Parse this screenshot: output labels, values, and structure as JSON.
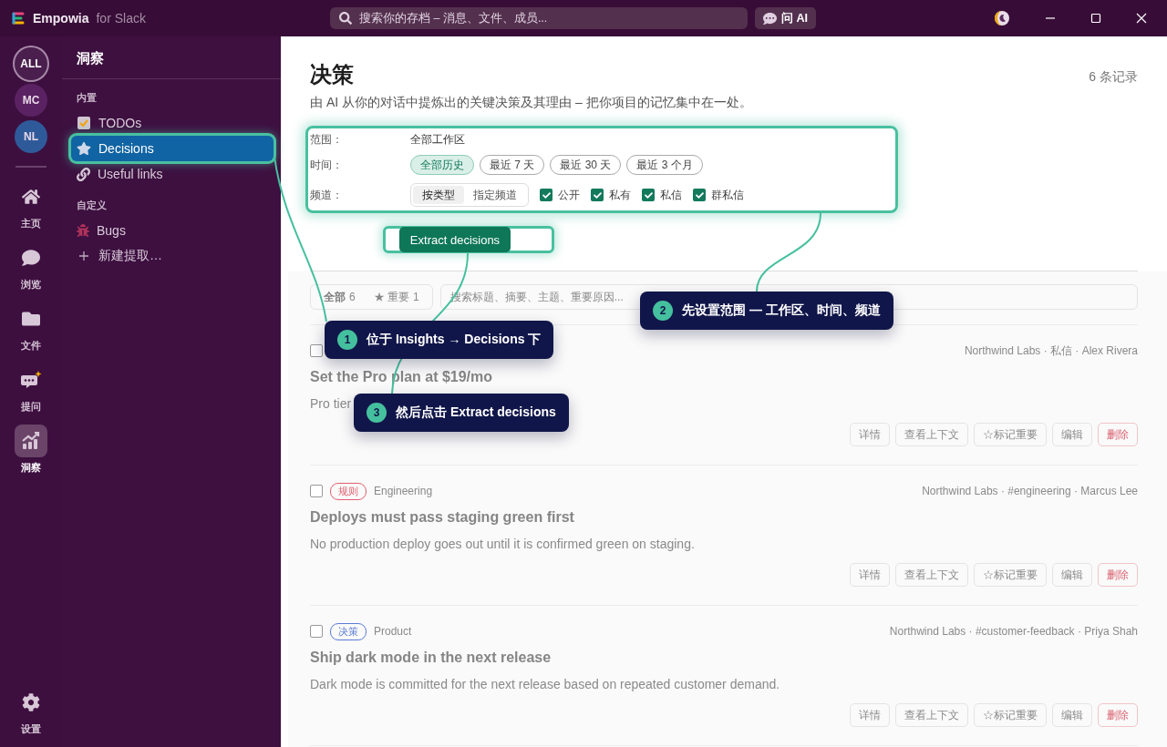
{
  "app": {
    "name": "Empowia",
    "suffix": "for Slack"
  },
  "search": {
    "placeholder": "搜索你的存档 – 消息、文件、成员..."
  },
  "ask_ai": "问 AI",
  "workspaces": [
    {
      "label": "ALL",
      "selected": true,
      "color": "#4a1f4e"
    },
    {
      "label": "MC",
      "selected": false,
      "color": "#5a2262"
    },
    {
      "label": "NL",
      "selected": false,
      "color": "#2f5a9a"
    }
  ],
  "nav": [
    {
      "label": "主页",
      "kind": "home",
      "selected": false
    },
    {
      "label": "浏览",
      "kind": "browse",
      "selected": false
    },
    {
      "label": "文件",
      "kind": "files",
      "selected": false
    },
    {
      "label": "提问",
      "kind": "ask",
      "selected": false
    },
    {
      "label": "洞察",
      "kind": "insights",
      "selected": true
    }
  ],
  "settings": {
    "label": "设置"
  },
  "sidebar": {
    "title": "洞察",
    "sections": [
      {
        "heading": "内置",
        "items": [
          {
            "label": "TODOs",
            "kind": "todo",
            "selected": false,
            "spotlight": false
          },
          {
            "label": "Decisions",
            "kind": "star",
            "selected": true,
            "spotlight": true
          },
          {
            "label": "Useful links",
            "kind": "link",
            "selected": false,
            "spotlight": false
          }
        ]
      },
      {
        "heading": "自定义",
        "items": [
          {
            "label": "Bugs",
            "kind": "bug",
            "selected": false,
            "spotlight": false
          },
          {
            "label": "新建提取…",
            "kind": "add",
            "selected": false,
            "spotlight": false
          }
        ]
      }
    ]
  },
  "page": {
    "title": "决策",
    "subtitle": "由 AI 从你的对话中提炼出的关键决策及其理由 – 把你项目的记忆集中在一处。",
    "count": "6 条记录"
  },
  "filters": {
    "spotlight": true,
    "scope_label": "范围：",
    "scope_value": "全部工作区",
    "time_label": "时间：",
    "time_options": [
      {
        "label": "全部历史",
        "selected": true
      },
      {
        "label": "最近 7 天",
        "selected": false
      },
      {
        "label": "最近 30 天",
        "selected": false
      },
      {
        "label": "最近 3 个月",
        "selected": false
      }
    ],
    "channel_label": "频道：",
    "channel_modes": [
      {
        "label": "按类型",
        "selected": true
      },
      {
        "label": "指定频道",
        "selected": false
      }
    ],
    "channel_types": [
      {
        "label": "公开",
        "checked": true
      },
      {
        "label": "私有",
        "checked": true
      },
      {
        "label": "私信",
        "checked": true
      },
      {
        "label": "群私信",
        "checked": true
      }
    ]
  },
  "extract": {
    "label": "Extract decisions",
    "spotlight": true
  },
  "list_tabs": [
    {
      "label": "全部",
      "count": "6",
      "selected": true
    },
    {
      "label": "★ 重要",
      "count": "1",
      "selected": false
    }
  ],
  "list_search": {
    "placeholder": "搜索标题、摘要、主题、重要原因..."
  },
  "records": [
    {
      "checked": false,
      "meta": "Northwind Labs · 私信 · Alex Rivera",
      "title": "Set the Pro plan at $19/mo",
      "summary": "Pro tier",
      "actions": [
        {
          "label": "详情",
          "kind": "normal"
        },
        {
          "label": "查看上下文",
          "kind": "normal"
        },
        {
          "label": "☆标记重要",
          "kind": "normal"
        },
        {
          "label": "编辑",
          "kind": "normal"
        },
        {
          "label": "删除",
          "kind": "danger"
        }
      ]
    },
    {
      "checked": false,
      "tag": {
        "label": "规则",
        "color": "#e0606e"
      },
      "category": "Engineering",
      "meta": "Northwind Labs · #engineering · Marcus Lee",
      "title": "Deploys must pass staging green first",
      "summary": "No production deploy goes out until it is confirmed green on staging.",
      "actions": [
        {
          "label": "详情",
          "kind": "normal"
        },
        {
          "label": "查看上下文",
          "kind": "normal"
        },
        {
          "label": "☆标记重要",
          "kind": "normal"
        },
        {
          "label": "编辑",
          "kind": "normal"
        },
        {
          "label": "删除",
          "kind": "danger"
        }
      ]
    },
    {
      "checked": false,
      "tag": {
        "label": "决策",
        "color": "#5b7bd5"
      },
      "category": "Product",
      "meta": "Northwind Labs · #customer-feedback · Priya Shah",
      "title": "Ship dark mode in the next release",
      "summary": "Dark mode is committed for the next release based on repeated customer demand.",
      "actions": [
        {
          "label": "详情",
          "kind": "normal"
        },
        {
          "label": "查看上下文",
          "kind": "normal"
        },
        {
          "label": "☆标记重要",
          "kind": "normal"
        },
        {
          "label": "编辑",
          "kind": "normal"
        },
        {
          "label": "删除",
          "kind": "danger"
        }
      ]
    }
  ],
  "callouts": [
    {
      "number": "1",
      "text": "位于 Insights → Decisions 下"
    },
    {
      "number": "2",
      "text": "先设置范围 — 工作区、时间、频道"
    },
    {
      "number": "3",
      "text": "然后点击 Extract decisions"
    }
  ]
}
